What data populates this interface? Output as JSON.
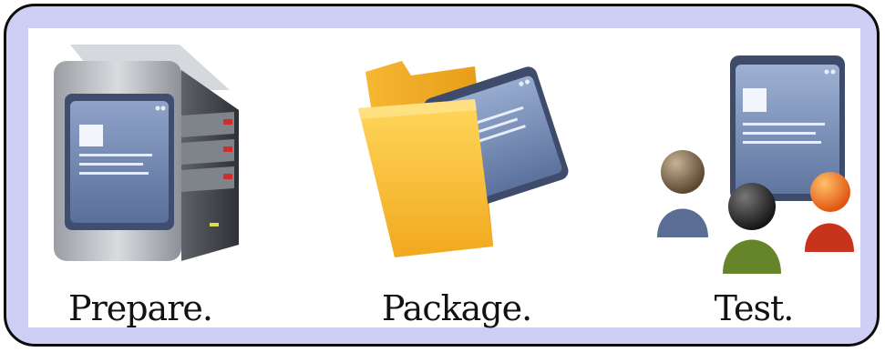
{
  "steps": [
    {
      "label": "Prepare.",
      "icon": "server-icon"
    },
    {
      "label": "Package.",
      "icon": "folder-icon"
    },
    {
      "label": "Test.",
      "icon": "users-window-icon"
    }
  ],
  "colors": {
    "frame_background": "#cfcff6",
    "frame_border": "#0c0c0c",
    "panel_background": "#ffffff",
    "label_text": "#121212"
  }
}
